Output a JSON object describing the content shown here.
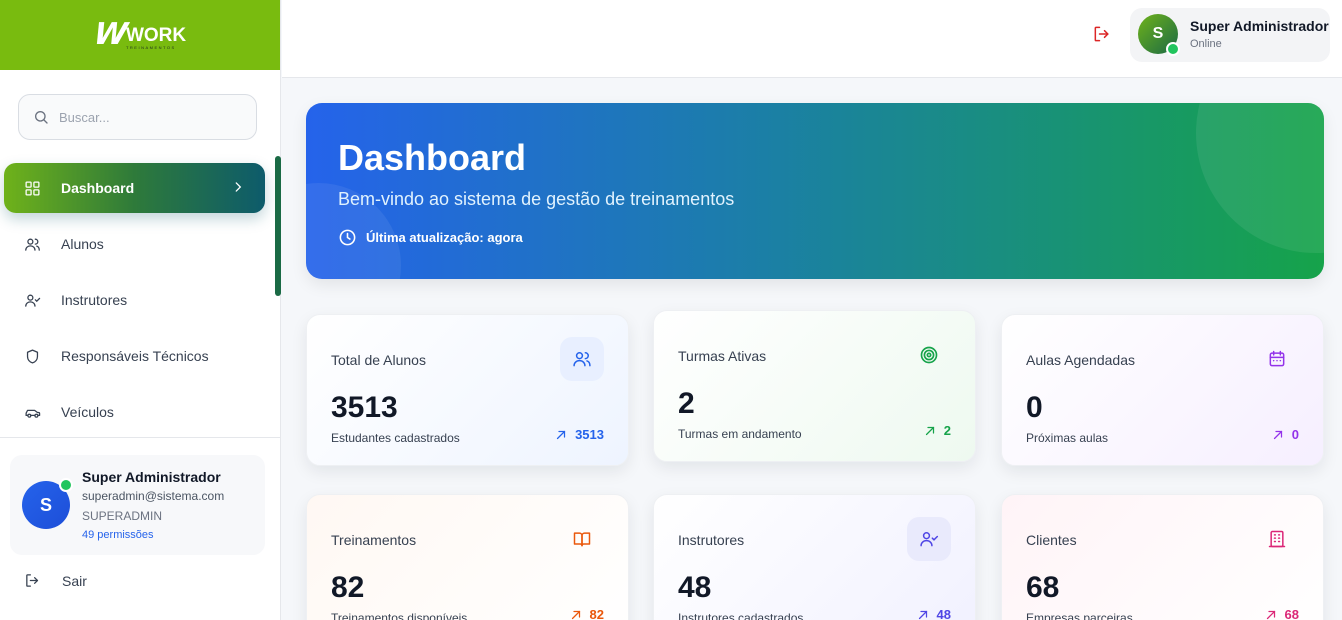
{
  "brand": {
    "logo_mark": "W",
    "logo_word": "WORK",
    "logo_sub": "TREINAMENTOS"
  },
  "search": {
    "placeholder": "Buscar..."
  },
  "sidebar": {
    "items": [
      {
        "label": "Dashboard",
        "icon": "grid-icon",
        "active": true
      },
      {
        "label": "Alunos",
        "icon": "users-icon"
      },
      {
        "label": "Instrutores",
        "icon": "user-check-icon"
      },
      {
        "label": "Responsáveis Técnicos",
        "icon": "shield-icon"
      },
      {
        "label": "Veículos",
        "icon": "car-icon"
      }
    ],
    "user": {
      "initial": "S",
      "name": "Super Administrador",
      "email": "superadmin@sistema.com",
      "role": "SUPERADMIN",
      "permissions": "49 permissões"
    },
    "logout_label": "Sair"
  },
  "topbar": {
    "user": {
      "initial": "S",
      "name": "Super Administrador",
      "status": "Online"
    }
  },
  "hero": {
    "title": "Dashboard",
    "subtitle": "Bem-vindo ao sistema de gestão de treinamentos",
    "updated": "Última atualização: agora"
  },
  "cards": [
    {
      "title": "Total de Alunos",
      "value": "3513",
      "desc": "Estudantes cadastrados",
      "trend": "3513",
      "icon": "users-icon",
      "color": "#2563eb"
    },
    {
      "title": "Turmas Ativas",
      "value": "2",
      "desc": "Turmas em andamento",
      "trend": "2",
      "icon": "target-icon",
      "color": "#16a34a"
    },
    {
      "title": "Aulas Agendadas",
      "value": "0",
      "desc": "Próximas aulas",
      "trend": "0",
      "icon": "calendar-icon",
      "color": "#9333ea"
    },
    {
      "title": "Treinamentos",
      "value": "82",
      "desc": "Treinamentos disponíveis",
      "trend": "82",
      "icon": "book-icon",
      "color": "#ea580c"
    },
    {
      "title": "Instrutores",
      "value": "48",
      "desc": "Instrutores cadastrados",
      "trend": "48",
      "icon": "user-check-icon",
      "color": "#4f46e5"
    },
    {
      "title": "Clientes",
      "value": "68",
      "desc": "Empresas parceiras",
      "trend": "68",
      "icon": "building-icon",
      "color": "#db2777"
    }
  ]
}
